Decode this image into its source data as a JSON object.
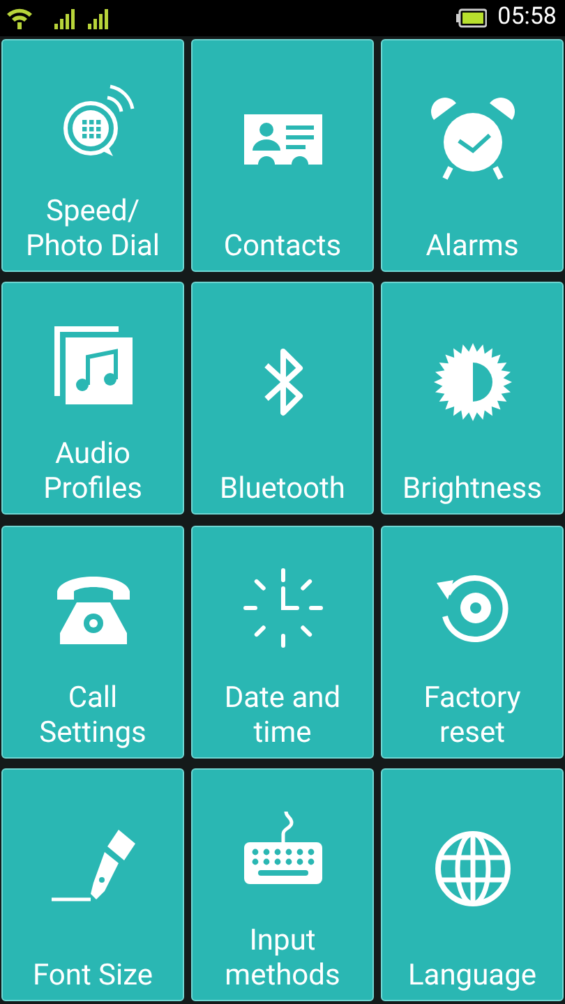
{
  "status_bar": {
    "time": "05:58"
  },
  "tiles": [
    {
      "kind": "speed_dial",
      "label": [
        "Speed/",
        "Photo Dial"
      ]
    },
    {
      "kind": "contacts",
      "label": [
        "Contacts"
      ]
    },
    {
      "kind": "alarm",
      "label": [
        "Alarms"
      ]
    },
    {
      "kind": "audio",
      "label": [
        "Audio",
        "Profiles"
      ]
    },
    {
      "kind": "bluetooth",
      "label": [
        "Bluetooth"
      ]
    },
    {
      "kind": "brightness",
      "label": [
        "Brightness"
      ]
    },
    {
      "kind": "call",
      "label": [
        "Call",
        "Settings"
      ]
    },
    {
      "kind": "datetime",
      "label": [
        "Date and",
        "time"
      ]
    },
    {
      "kind": "reset",
      "label": [
        "Factory",
        "reset"
      ]
    },
    {
      "kind": "font",
      "label": [
        "Font Size"
      ]
    },
    {
      "kind": "keyboard",
      "label": [
        "Input",
        "methods"
      ]
    },
    {
      "kind": "language",
      "label": [
        "Language"
      ]
    }
  ]
}
